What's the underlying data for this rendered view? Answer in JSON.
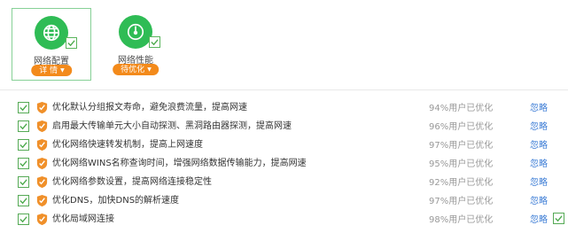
{
  "cards": [
    {
      "label": "网络配置",
      "button": "详 情",
      "icon": "globe-icon",
      "selected": true
    },
    {
      "label": "网络性能",
      "button": "待优化",
      "icon": "speedometer-icon",
      "selected": false
    }
  ],
  "items": [
    {
      "text": "优化默认分组报文寿命，避免浪费流量，提高网速",
      "percent": "94%用户已优化",
      "action": "忽略"
    },
    {
      "text": "启用最大传输单元大小自动探测、黑洞路由器探测，提高网速",
      "percent": "96%用户已优化",
      "action": "忽略"
    },
    {
      "text": "优化网络快速转发机制，提高上网速度",
      "percent": "97%用户已优化",
      "action": "忽略"
    },
    {
      "text": "优化网络WINS名称查询时间，增强网络数据传输能力，提高网速",
      "percent": "95%用户已优化",
      "action": "忽略"
    },
    {
      "text": "优化网络参数设置，提高网络连接稳定性",
      "percent": "92%用户已优化",
      "action": "忽略"
    },
    {
      "text": "优化DNS，加快DNS的解析速度",
      "percent": "97%用户已优化",
      "action": "忽略"
    },
    {
      "text": "优化局域网连接",
      "percent": "98%用户已优化",
      "action": "忽略"
    }
  ],
  "colors": {
    "accent_green": "#2fbc55",
    "accent_orange": "#f38a1b",
    "link_blue": "#3a7bd5"
  }
}
